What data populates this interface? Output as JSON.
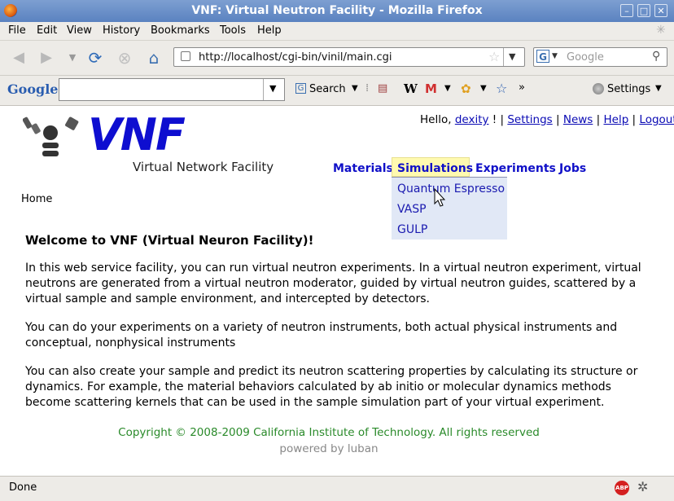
{
  "window": {
    "title": "VNF: Virtual Neutron Facility - Mozilla Firefox"
  },
  "menubar": {
    "items": [
      "File",
      "Edit",
      "View",
      "History",
      "Bookmarks",
      "Tools",
      "Help"
    ]
  },
  "navbar": {
    "url": "http://localhost/cgi-bin/vinil/main.cgi",
    "search_placeholder": "Google"
  },
  "google_toolbar": {
    "logo": "Google",
    "search_label": "Search",
    "settings_label": "Settings",
    "query_value": ""
  },
  "page": {
    "logo_text": "VNF",
    "logo_subtitle": "Virtual Network Facility",
    "user_bar": {
      "hello": "Hello,",
      "username": "dexity",
      "bang": "!",
      "settings": "Settings",
      "news": "News",
      "help": "Help",
      "logout": "Logout"
    },
    "nav": {
      "materials": "Materials",
      "simulations": "Simulations",
      "experiments": "Experiments",
      "jobs": "Jobs"
    },
    "submenu": [
      "Quantum Espresso",
      "VASP",
      "GULP"
    ],
    "breadcrumb": "Home",
    "heading": "Welcome to VNF (Virtual Neuron Facility)!",
    "paragraphs": [
      "In this web service facility, you can run virtual neutron experiments. In a virtual neutron experiment, virtual neutrons are generated from a virtual neutron moderator, guided by virtual neutron guides, scattered by a virtual sample and sample environment, and intercepted by detectors.",
      "You can do your experiments on a variety of neutron instruments, both actual physical instruments and conceptual, nonphysical instruments",
      "You can also create your sample and predict its neutron scattering properties by calculating its structure or dynamics. For example, the material behaviors calculated by ab initio or molecular dynamics methods become scattering kernels that can be used in the sample simulation part of your virtual experiment."
    ],
    "copyright": "Copyright © 2008-2009 California Institute of Technology. All rights reserved",
    "powered_by": "powered by luban"
  },
  "statusbar": {
    "text": "Done",
    "abp_label": "ABP"
  },
  "colors": {
    "nav_link": "#1010c8",
    "copyright": "#2a8a2a",
    "highlight": "#fffab0",
    "submenu_bg": "#e1e8f6"
  }
}
